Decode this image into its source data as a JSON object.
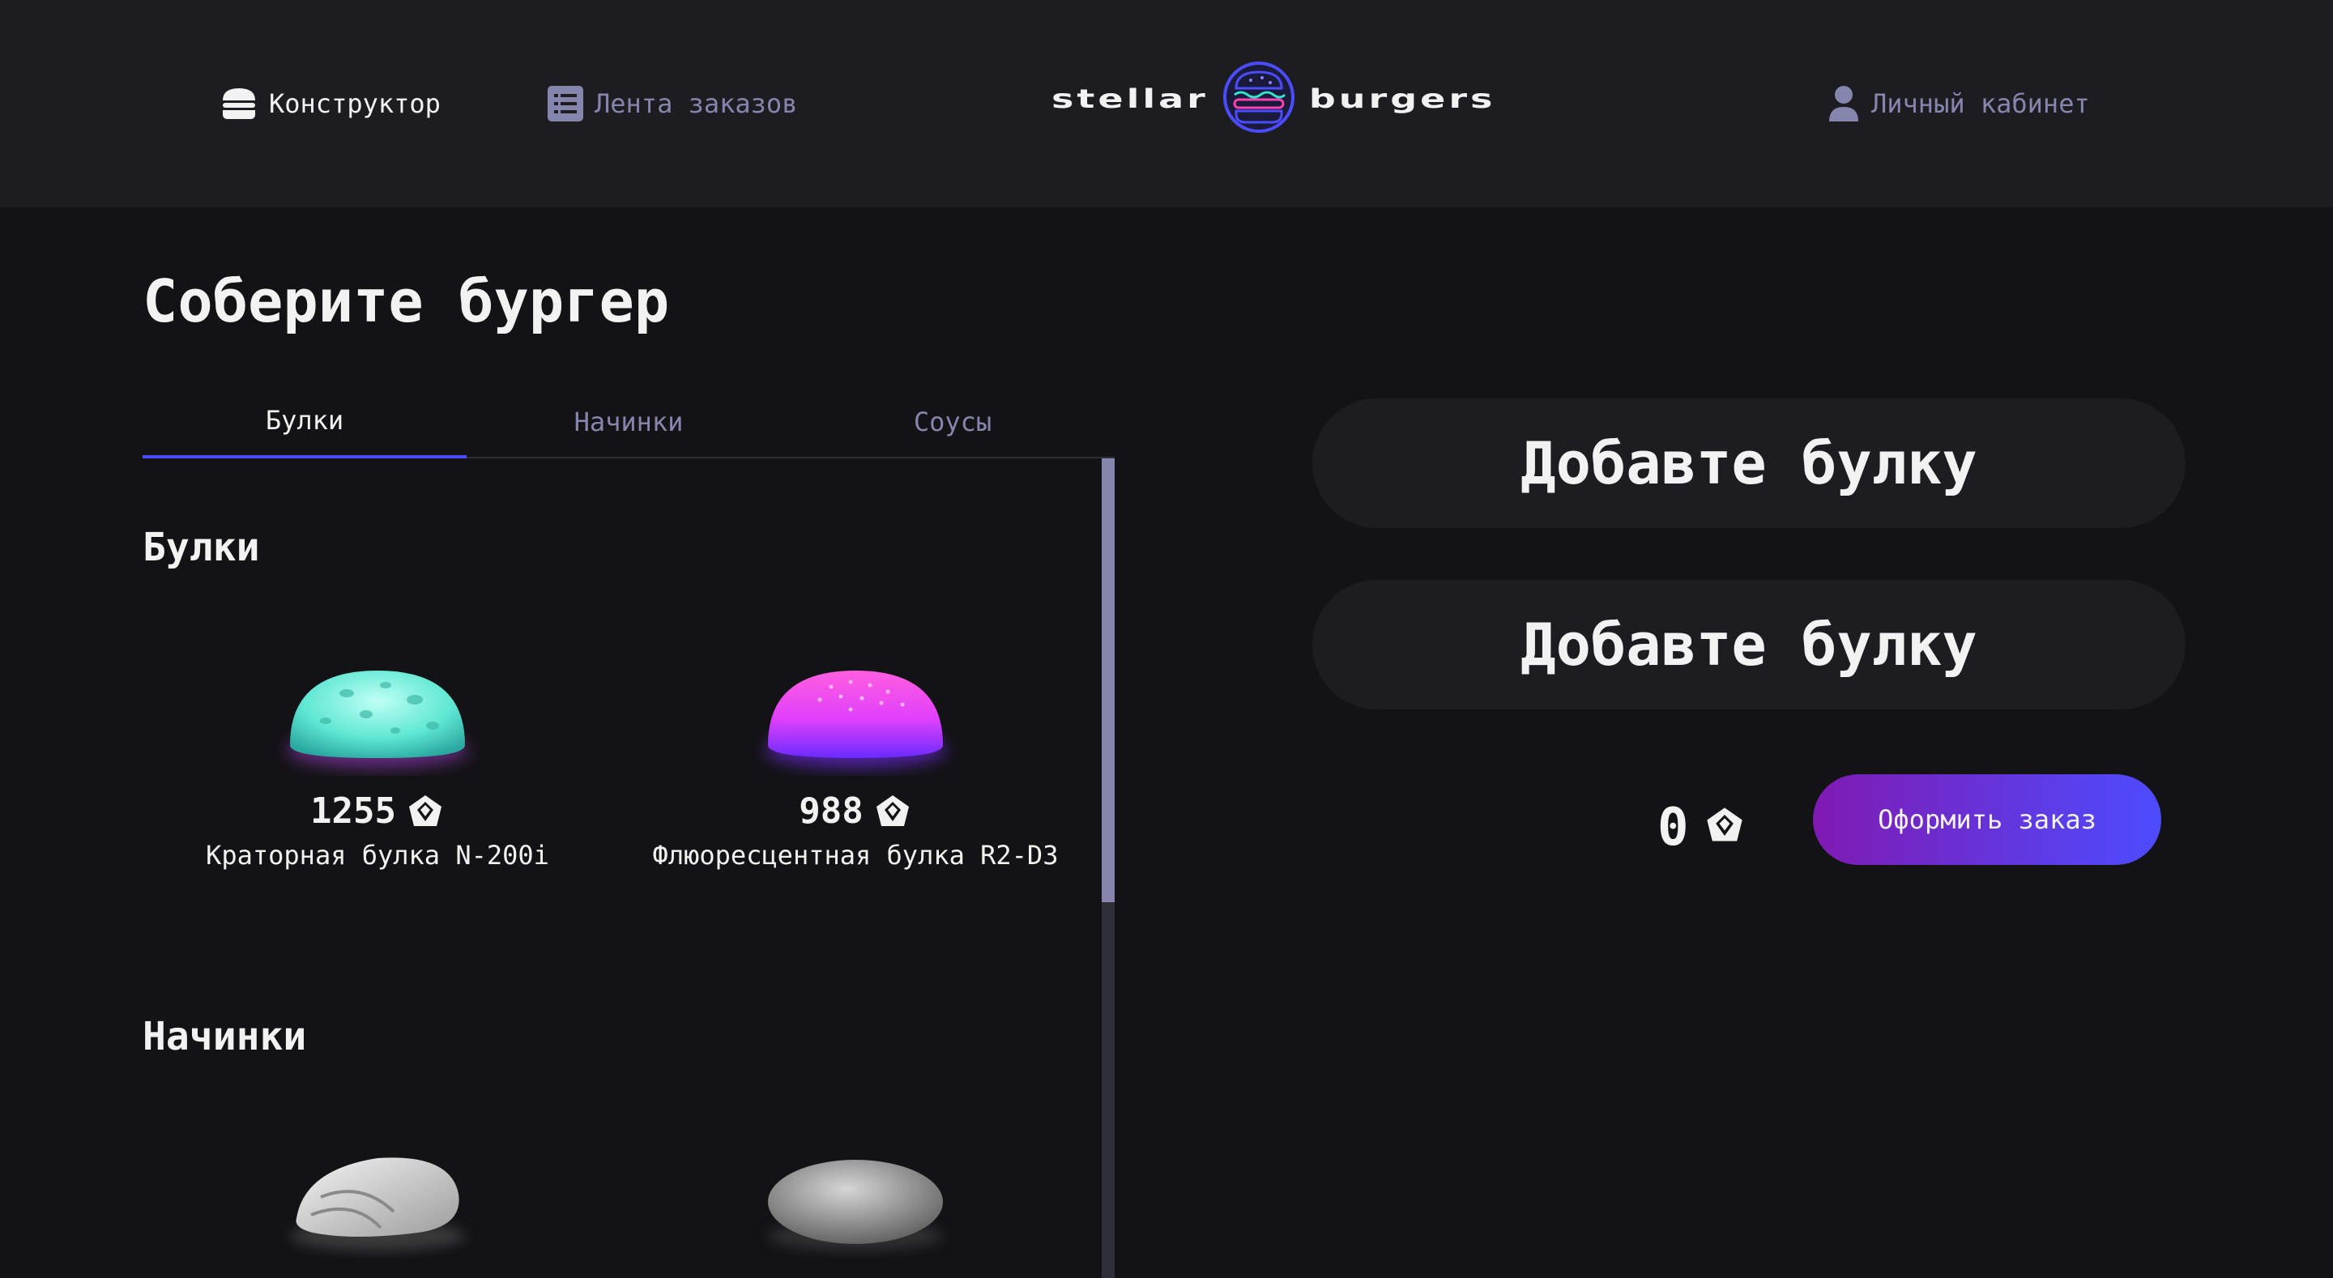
{
  "header": {
    "nav_constructor": "Конструктор",
    "nav_feed": "Лента заказов",
    "logo_left": "stellar",
    "logo_right": "burgers",
    "nav_profile": "Личный кабинет"
  },
  "main": {
    "title": "Соберите бургер",
    "tabs": [
      {
        "label": "Булки",
        "active": true
      },
      {
        "label": "Начинки",
        "active": false
      },
      {
        "label": "Соусы",
        "active": false
      }
    ],
    "sections": [
      {
        "title": "Булки",
        "items": [
          {
            "price": "1255",
            "name": "Краторная булка N-200i",
            "color": "#6ff5e0"
          },
          {
            "price": "988",
            "name": "Флюоресцентная булка R2-D3",
            "color": "#e040fb"
          }
        ]
      },
      {
        "title": "Начинки",
        "items": [
          {
            "price": "",
            "name": "",
            "color": "#d9d9d9"
          },
          {
            "price": "",
            "name": "",
            "color": "#9a9a9a"
          }
        ]
      }
    ]
  },
  "constructor": {
    "top_placeholder": "Добавте булку",
    "bottom_placeholder": "Добавте булку",
    "total": "0",
    "order_button": "Оформить заказ"
  },
  "colors": {
    "accent_start": "#801ab2",
    "accent_end": "#4c4cff",
    "inactive_text": "#8585ad",
    "panel_bg": "#1c1c21",
    "page_bg": "#131316"
  },
  "icons": {
    "constructor": "burger-icon",
    "feed": "list-icon",
    "profile": "profile-icon",
    "currency": "currency-icon"
  }
}
